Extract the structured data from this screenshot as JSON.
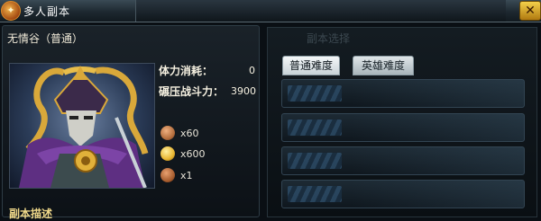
{
  "window": {
    "title": "多人副本",
    "logo_glyph": "✦",
    "close_label": "✕"
  },
  "dungeon": {
    "name": "无情谷（普通）"
  },
  "stats": [
    {
      "label": "体力消耗：",
      "value": "0"
    },
    {
      "label": "碾压战斗力：",
      "value": "3900"
    }
  ],
  "rewards": [
    {
      "icon": "pouch-icon",
      "qty": "x60",
      "color": "#b06a3a"
    },
    {
      "icon": "gold-coin-icon",
      "qty": "x600",
      "color": "#e7b531"
    },
    {
      "icon": "bag-icon",
      "qty": "x1",
      "color": "#a45a2c"
    }
  ],
  "section_title": "副本描述",
  "right": {
    "watermark": "副本选择",
    "tabs": [
      {
        "label": "普通难度",
        "active": true
      },
      {
        "label": "英雄难度",
        "active": false
      }
    ],
    "slots": [
      {},
      {},
      {},
      {}
    ]
  },
  "colors": {
    "accent_gold": "#f0d98a",
    "panel": "#141c22"
  }
}
